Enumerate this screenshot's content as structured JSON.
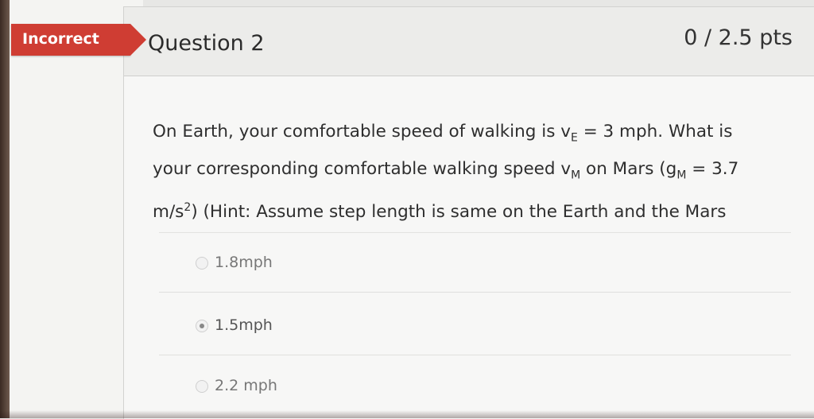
{
  "status": {
    "label": "Incorrect",
    "color": "#cf3d33"
  },
  "question": {
    "title": "Question 2",
    "points": "0 / 2.5 pts",
    "text": {
      "line1_a": "On Earth, your comfortable speed of walking is v",
      "line1_sub": "E",
      "line1_b": " = 3 mph. What is",
      "line2_a": "your corresponding comfortable walking speed v",
      "line2_sub1": "M",
      "line2_b": " on Mars (g",
      "line2_sub2": "M",
      "line2_c": " = 3.7",
      "line3_a": "m/s",
      "line3_sup": "2",
      "line3_b": ") (Hint: Assume step length is same on the Earth and the Mars"
    }
  },
  "answers": [
    {
      "label": "1.8mph",
      "selected": false
    },
    {
      "label": "1.5mph",
      "selected": true
    },
    {
      "label": "2.2 mph",
      "selected": false
    }
  ]
}
